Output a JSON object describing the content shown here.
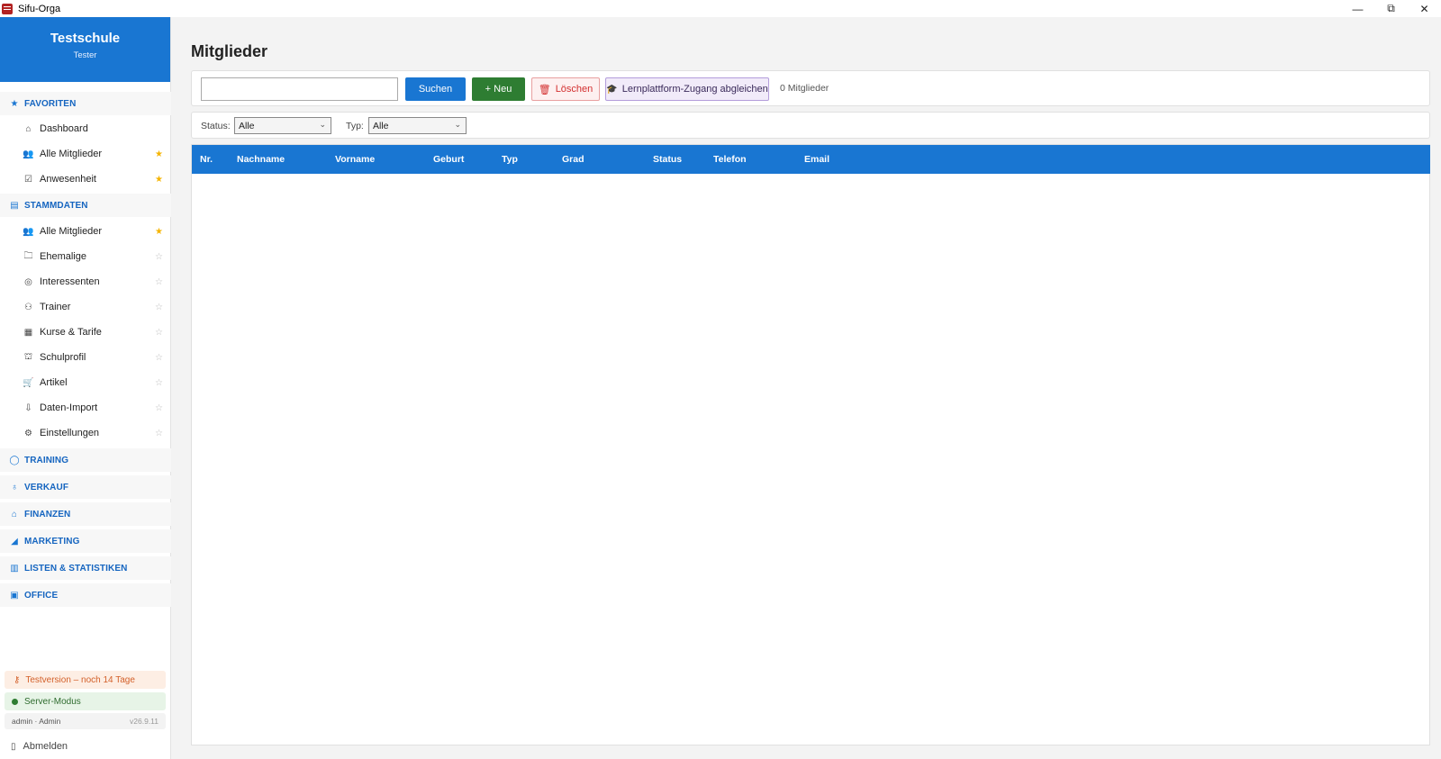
{
  "window": {
    "title": "Sifu-Orga",
    "controls": [
      "—",
      "⧉",
      "✕"
    ]
  },
  "sidebar": {
    "school_name": "Testschule",
    "user_role": "Tester",
    "favorites": {
      "title": "FAVORITEN",
      "items": [
        {
          "label": "Dashboard",
          "icon": "house-icon",
          "star": ""
        },
        {
          "label": "Alle Mitglieder",
          "icon": "people-icon",
          "star": "★"
        },
        {
          "label": "Anwesenheit",
          "icon": "checkbox-icon",
          "star": "★"
        }
      ]
    },
    "stammdaten": {
      "title": "STAMMDATEN",
      "items": [
        {
          "label": "Alle Mitglieder",
          "icon": "people-icon",
          "star": "★"
        },
        {
          "label": "Ehemalige",
          "icon": "folder-icon",
          "star": "☆"
        },
        {
          "label": "Interessenten",
          "icon": "target-icon",
          "star": "☆"
        },
        {
          "label": "Trainer",
          "icon": "trainer-icon",
          "star": "☆"
        },
        {
          "label": "Kurse & Tarife",
          "icon": "calendar-icon",
          "star": "☆"
        },
        {
          "label": "Schulprofil",
          "icon": "school-icon",
          "star": "☆"
        },
        {
          "label": "Artikel",
          "icon": "cart-icon",
          "star": "☆"
        },
        {
          "label": "Daten-Import",
          "icon": "import-icon",
          "star": "☆"
        },
        {
          "label": "Einstellungen",
          "icon": "gear-icon",
          "star": "☆"
        }
      ]
    },
    "sections": [
      {
        "label": "TRAINING",
        "icon": "training-icon"
      },
      {
        "label": "VERKAUF",
        "icon": "sale-icon"
      },
      {
        "label": "FINANZEN",
        "icon": "bank-icon"
      },
      {
        "label": "MARKETING",
        "icon": "megaphone-icon"
      },
      {
        "label": "LISTEN & STATISTIKEN",
        "icon": "chart-icon"
      },
      {
        "label": "OFFICE",
        "icon": "office-icon"
      }
    ],
    "trial": "Testversion – noch 14 Tage",
    "server_mode": "Server-Modus",
    "login_info": "admin · Admin",
    "version": "v26.9.11",
    "logout": "Abmelden"
  },
  "main": {
    "title": "Mitglieder",
    "search": {
      "value": "",
      "placeholder": ""
    },
    "buttons": {
      "search": "Suchen",
      "new": "+ Neu",
      "delete": "Löschen",
      "sync": "Lernplattform-Zugang abgleichen"
    },
    "count": "0 Mitglieder",
    "filters": {
      "status_label": "Status:",
      "status_value": "Alle",
      "type_label": "Typ:",
      "type_value": "Alle"
    },
    "table": {
      "columns": [
        "Nr.",
        "Nachname",
        "Vorname",
        "Geburt",
        "Typ",
        "Grad",
        "Status",
        "Telefon",
        "Email"
      ],
      "rows": []
    }
  },
  "colors": {
    "primary": "#1976d2",
    "success": "#2e7d32",
    "danger": "#d32f2f",
    "purple": "#5e35b1",
    "star": "#f5b400"
  }
}
